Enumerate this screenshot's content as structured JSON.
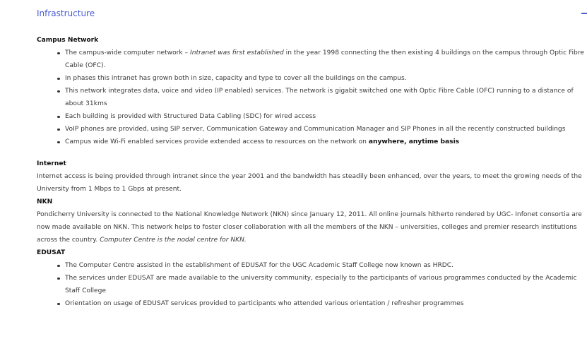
{
  "accordion": {
    "title": "Infrastructure"
  },
  "campus_network": {
    "heading": "Campus Network",
    "items": [
      {
        "pre": "The campus-wide computer network – ",
        "em": "Intranet was first established",
        "post": " in the year 1998 connecting the then existing 4 buildings on the campus through Optic Fibre Cable (OFC)."
      },
      {
        "text": "In phases this intranet has grown both in size, capacity and type to cover all the buildings on the campus."
      },
      {
        "text": "This network integrates data, voice and video (IP enabled) services. The network is gigabit switched one with Optic Fibre Cable (OFC) running to a distance of about 31kms"
      },
      {
        "text": "Each building is provided with Structured Data Cabling (SDC) for wired access"
      },
      {
        "text": "VoIP phones are provided, using SIP server, Communication Gateway and Communication Manager and SIP Phones in all the recently constructed buildings"
      },
      {
        "pre": "Campus wide Wi-Fi enabled services provide extended access to resources on the network on ",
        "strong": "anywhere, anytime basis"
      }
    ]
  },
  "internet": {
    "heading": "Internet",
    "text": "Internet access is being provided through intranet since the year 2001 and the bandwidth has steadily been enhanced, over the years, to meet the growing needs of the University from 1 Mbps to 1 Gbps at present."
  },
  "nkn": {
    "heading": "NKN",
    "text": "Pondicherry University is connected to the National Knowledge Network (NKN) since January 12, 2011. All online journals hitherto rendered by UGC- Infonet consortia are now made available on NKN. This network helps to foster closer collaboration with all the members of the NKN – universities, colleges and premier research institutions across the country. ",
    "em": "Computer Centre is the nodal centre for NKN."
  },
  "edusat": {
    "heading": "EDUSAT",
    "items": [
      "The Computer Centre assisted in the establishment of EDUSAT for the UGC Academic Staff College now known as HRDC.",
      "The services under EDUSAT are made available to the university community, especially to the participants of various programmes conducted by the Academic Staff College",
      "Orientation on usage of EDUSAT services provided to participants who attended various orientation / refresher programmes"
    ]
  }
}
